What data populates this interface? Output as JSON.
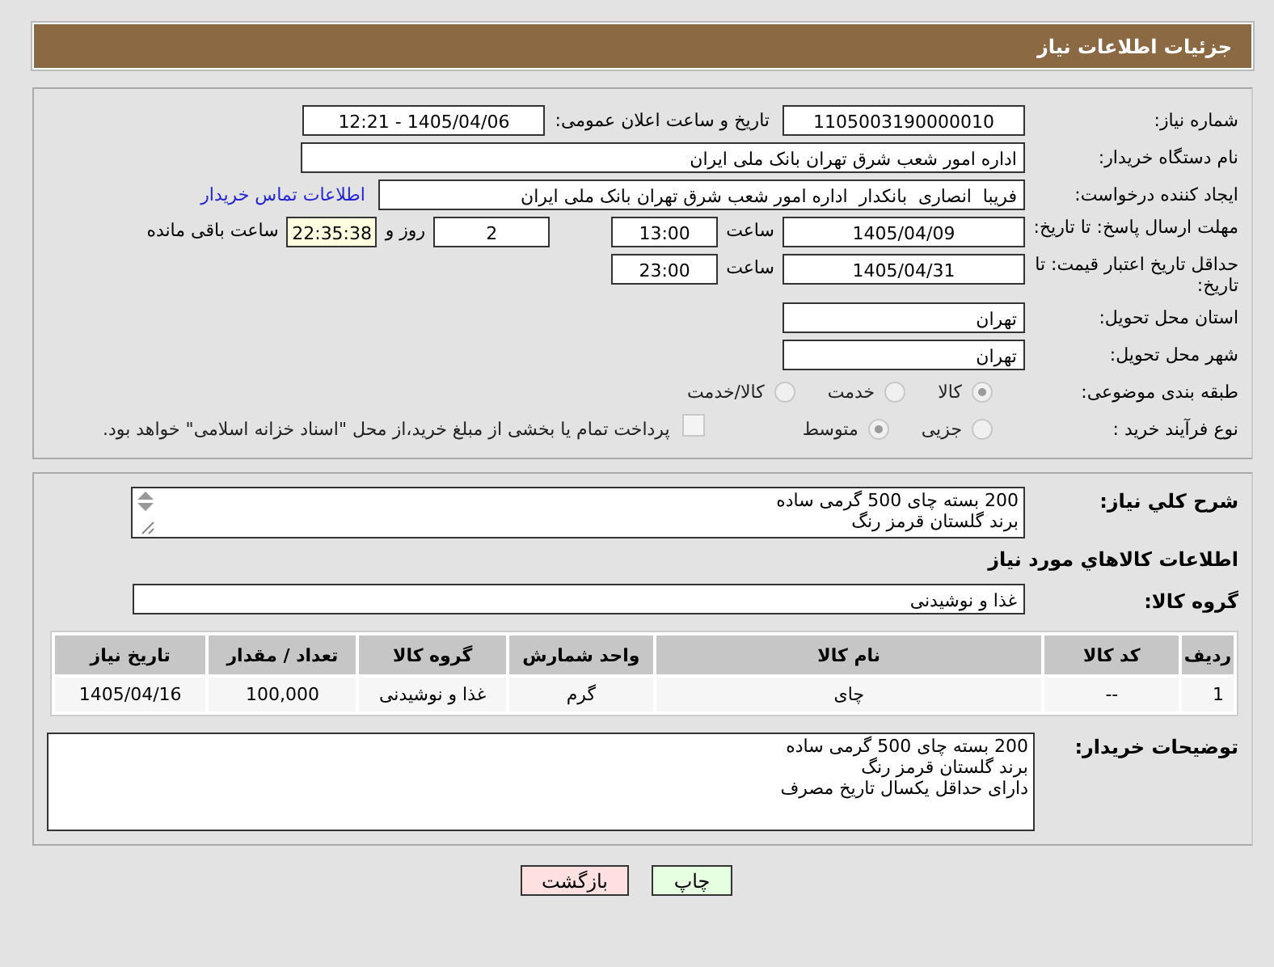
{
  "header": {
    "title": "جزئیات اطلاعات نیاز"
  },
  "need_number": {
    "label": "شماره نیاز:",
    "value": "1105003190000010"
  },
  "announce": {
    "label": "تاریخ و ساعت اعلان عمومی:",
    "value": "1405/04/06 - 12:21"
  },
  "buyer_org": {
    "label": "نام دستگاه خریدار:",
    "value": "اداره امور شعب شرق تهران بانک ملی ایران"
  },
  "requester": {
    "label": "ایجاد کننده درخواست:",
    "value": "فریبا  انصاری  بانکدار  اداره امور شعب شرق تهران بانک ملی ایران",
    "link": "اطلاعات تماس خریدار"
  },
  "deadline": {
    "label": "مهلت ارسال پاسخ: تا تاریخ:",
    "date": "1405/04/09",
    "time_label": "ساعت",
    "time": "13:00",
    "days": "2",
    "days_label": "روز و",
    "remaining": "22:35:38",
    "remaining_label": "ساعت باقی مانده"
  },
  "price_validity": {
    "label": "حداقل تاریخ اعتبار قیمت: تا تاریخ:",
    "date": "1405/04/31",
    "time_label": "ساعت",
    "time": "23:00"
  },
  "province": {
    "label": "استان محل تحویل:",
    "value": "تهران"
  },
  "city": {
    "label": "شهر محل تحویل:",
    "value": "تهران"
  },
  "category": {
    "label": "طبقه بندی موضوعی:",
    "options": [
      {
        "label": "کالا",
        "selected": true
      },
      {
        "label": "خدمت",
        "selected": false
      },
      {
        "label": "کالا/خدمت",
        "selected": false
      }
    ]
  },
  "process": {
    "label": "نوع فرآیند خرید :",
    "options": [
      {
        "label": "جزیی",
        "selected": false
      },
      {
        "label": "متوسط",
        "selected": true
      }
    ],
    "payment": {
      "checked": false,
      "text": "پرداخت تمام یا بخشی از مبلغ خرید،از محل \"اسناد خزانه اسلامی\" خواهد بود."
    }
  },
  "description": {
    "label": "شرح کلي نياز:",
    "text": "200 بسته چای 500 گرمی ساده\nبرند گلستان قرمز رنگ"
  },
  "goods_heading": "اطلاعات کالاهاي مورد نياز",
  "goods_group": {
    "label": "گروه کالا:",
    "value": "غذا و نوشیدنی"
  },
  "table": {
    "columns": [
      "ردیف",
      "کد کالا",
      "نام کالا",
      "واحد شمارش",
      "گروه کالا",
      "تعداد / مقدار",
      "تاریخ نیاز"
    ],
    "rows": [
      [
        "1",
        "--",
        "چای",
        "گرم",
        "غذا و نوشیدنی",
        "100,000",
        "1405/04/16"
      ]
    ]
  },
  "buyer_notes": {
    "label": "توضیحات خریدار:",
    "text": "200 بسته چای 500 گرمی ساده\nبرند گلستان قرمز رنگ\nدارای حداقل یکسال تاریخ مصرف"
  },
  "buttons": [
    {
      "kind": "print",
      "label": "چاپ"
    },
    {
      "kind": "back",
      "label": "بازگشت"
    }
  ]
}
